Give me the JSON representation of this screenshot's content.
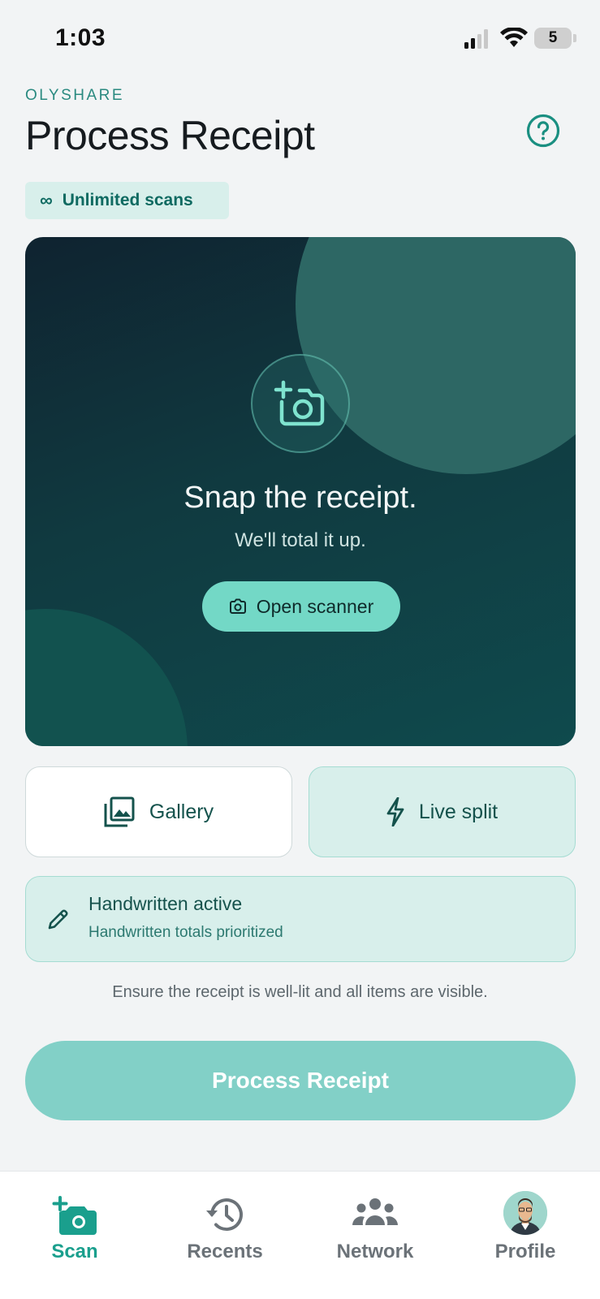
{
  "status_bar": {
    "time": "1:03",
    "battery": "5"
  },
  "header": {
    "brand": "OLYSHARE",
    "title": "Process Receipt",
    "badge_icon": "∞",
    "badge_label": "Unlimited scans"
  },
  "hero": {
    "title": "Snap the receipt.",
    "subtitle": "We'll total it up.",
    "scanner_label": "Open scanner"
  },
  "options": {
    "gallery_label": "Gallery",
    "live_split_label": "Live split"
  },
  "handwritten": {
    "title": "Handwritten active",
    "subtitle": "Handwritten totals prioritized"
  },
  "hint": "Ensure the receipt is well-lit and all items are visible.",
  "process_button": "Process Receipt",
  "tabs": [
    {
      "label": "Scan",
      "icon": "camera-plus-icon",
      "active": true
    },
    {
      "label": "Recents",
      "icon": "history-icon",
      "active": false
    },
    {
      "label": "Network",
      "icon": "people-icon",
      "active": false
    },
    {
      "label": "Profile",
      "icon": "avatar",
      "active": false
    }
  ],
  "colors": {
    "accent": "#1a9f8d",
    "hero_start": "#0f2330",
    "hero_end": "#0f4a4d",
    "pill": "#73d8c6",
    "soft": "#d8efeb",
    "cta": "#82d0c7"
  }
}
